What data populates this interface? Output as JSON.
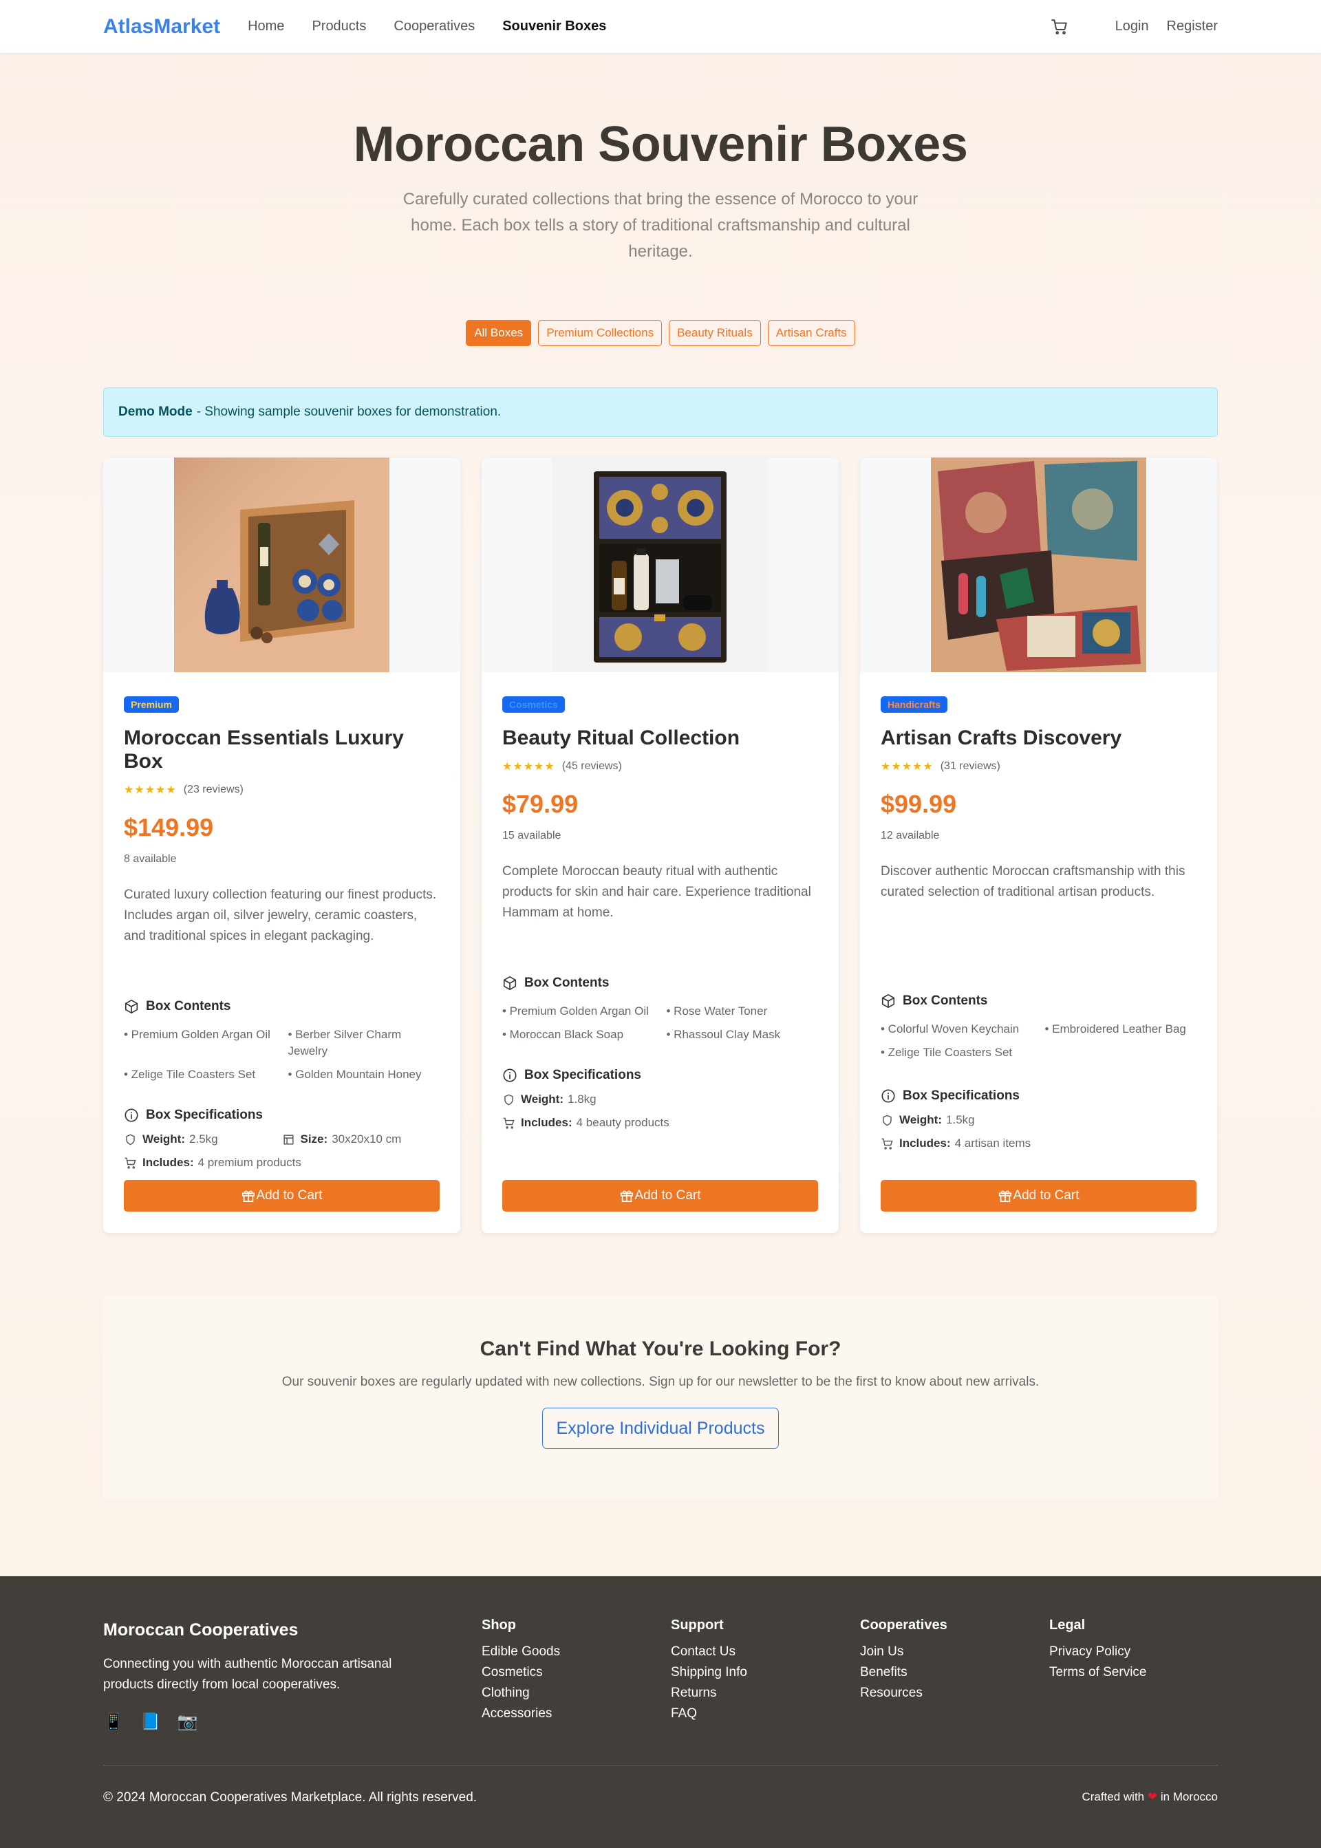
{
  "nav": {
    "brand": "AtlasMarket",
    "links": [
      "Home",
      "Products",
      "Cooperatives",
      "Souvenir Boxes"
    ],
    "login": "Login",
    "register": "Register"
  },
  "hero": {
    "title": "Moroccan Souvenir Boxes",
    "subtitle": "Carefully curated collections that bring the essence of Morocco to your home. Each box tells a story of traditional craftsmanship and cultural heritage."
  },
  "filters": [
    "All Boxes",
    "Premium Collections",
    "Beauty Rituals",
    "Artisan Crafts"
  ],
  "alert": {
    "bold": "Demo Mode",
    "text": "- Showing sample souvenir boxes for demonstration."
  },
  "labels": {
    "box_contents": "Box Contents",
    "box_specs": "Box Specifications",
    "weight": "Weight:",
    "size": "Size:",
    "includes": "Includes:",
    "add_to_cart": "Add to Cart"
  },
  "cards": [
    {
      "badge": "Premium",
      "title": "Moroccan Essentials Luxury Box",
      "stars": "★★★★★",
      "reviews": "(23 reviews)",
      "price": "$149.99",
      "stock": "8 available",
      "description": "Curated luxury collection featuring our finest products. Includes argan oil, silver jewelry, ceramic coasters, and traditional spices in elegant packaging.",
      "contents": [
        "• Premium Golden Argan Oil",
        "• Berber Silver Charm Jewelry",
        "• Zelige Tile Coasters Set",
        "• Golden Mountain Honey"
      ],
      "weight": "2.5kg",
      "size": "30x20x10 cm",
      "includes": "4 premium products"
    },
    {
      "badge": "Cosmetics",
      "title": "Beauty Ritual Collection",
      "stars": "★★★★★",
      "reviews": "(45 reviews)",
      "price": "$79.99",
      "stock": "15 available",
      "description": "Complete Moroccan beauty ritual with authentic products for skin and hair care. Experience traditional Hammam at home.",
      "contents": [
        "• Premium Golden Argan Oil",
        "• Rose Water Toner",
        "• Moroccan Black Soap",
        "• Rhassoul Clay Mask"
      ],
      "weight": "1.8kg",
      "includes": "4 beauty products"
    },
    {
      "badge": "Handicrafts",
      "title": "Artisan Crafts Discovery",
      "stars": "★★★★★",
      "reviews": "(31 reviews)",
      "price": "$99.99",
      "stock": "12 available",
      "description": "Discover authentic Moroccan craftsmanship with this curated selection of traditional artisan products.",
      "contents": [
        "• Colorful Woven Keychain",
        "• Embroidered Leather Bag",
        "• Zelige Tile Coasters Set"
      ],
      "weight": "1.5kg",
      "includes": "4 artisan items"
    }
  ],
  "cta": {
    "title": "Can't Find What You're Looking For?",
    "text": "Our souvenir boxes are regularly updated with new collections. Sign up for our newsletter to be the first to know about new arrivals.",
    "button": "Explore Individual Products"
  },
  "footer": {
    "brand": "Moroccan Cooperatives",
    "tagline": "Connecting you with authentic Moroccan artisanal products directly from local cooperatives.",
    "social_icons": [
      "📱",
      "📘",
      "📷"
    ],
    "columns": [
      {
        "title": "Shop",
        "links": [
          "Edible Goods",
          "Cosmetics",
          "Clothing",
          "Accessories"
        ]
      },
      {
        "title": "Support",
        "links": [
          "Contact Us",
          "Shipping Info",
          "Returns",
          "FAQ"
        ]
      },
      {
        "title": "Cooperatives",
        "links": [
          "Join Us",
          "Benefits",
          "Resources"
        ]
      },
      {
        "title": "Legal",
        "links": [
          "Privacy Policy",
          "Terms of Service"
        ]
      }
    ],
    "copyright": "© 2024 Moroccan Cooperatives Marketplace. All rights reserved.",
    "made_prefix": "Crafted with",
    "made_heart": "❤",
    "made_suffix": "in Morocco"
  },
  "colors": {
    "accent": "#ee7522",
    "brand": "#3b82e6",
    "badge_bg": "#1668f0",
    "footer_bg": "#423e3a",
    "alert_bg": "#cff4fc"
  }
}
